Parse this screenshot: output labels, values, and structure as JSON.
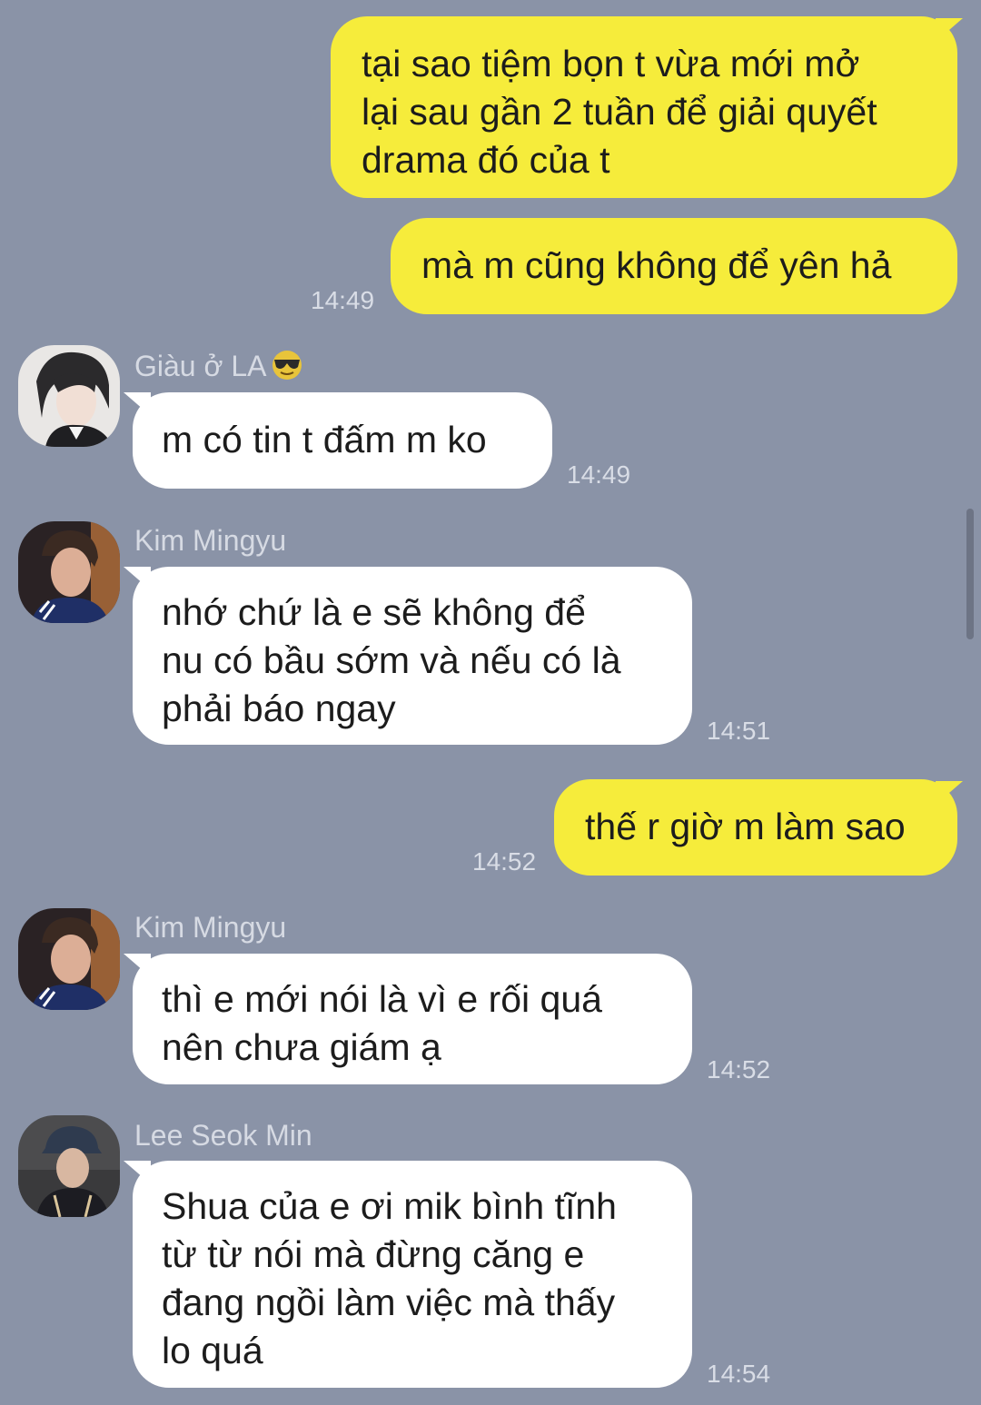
{
  "messages": [
    {
      "id": "m1",
      "direction": "out",
      "text": "tại sao tiệm bọn t vừa mới mở\nlại sau gần 2 tuần để giải quyết\ndrama đó của t"
    },
    {
      "id": "m2",
      "direction": "out",
      "text": "mà m cũng không để yên hả",
      "time": "14:49"
    },
    {
      "id": "m3",
      "direction": "in",
      "sender": "Giàu ở LA",
      "sender_emoji": "sunglasses-emoji",
      "avatar": "avatar-giau",
      "text": "m có tin t đấm m ko",
      "time": "14:49"
    },
    {
      "id": "m4",
      "direction": "in",
      "sender": "Kim Mingyu",
      "avatar": "avatar-mingyu",
      "text": "nhớ chứ là e sẽ không để\nnu có bầu sớm và nếu có là\nphải báo ngay",
      "time": "14:51"
    },
    {
      "id": "m5",
      "direction": "out",
      "text": "thế r giờ m làm sao",
      "time": "14:52"
    },
    {
      "id": "m6",
      "direction": "in",
      "sender": "Kim Mingyu",
      "avatar": "avatar-mingyu",
      "text": "thì e mới nói là vì e rối quá\nnên chưa giám ạ",
      "time": "14:52"
    },
    {
      "id": "m7",
      "direction": "in",
      "sender": "Lee Seok Min",
      "avatar": "avatar-seokmin",
      "text": "Shua của e ơi mik bình tĩnh\ntừ từ nói mà đừng căng e\nđang ngồi làm việc mà thấy\nlo quá",
      "time": "14:54"
    }
  ],
  "colors": {
    "background": "#8a93a7",
    "outgoing_bubble": "#f6ec3b",
    "incoming_bubble": "#ffffff"
  }
}
